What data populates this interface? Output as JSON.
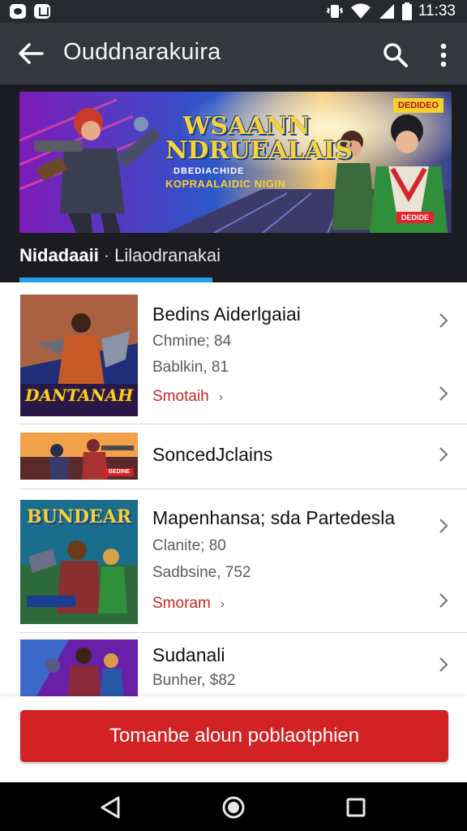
{
  "status_bar": {
    "time": "11:33",
    "icons": [
      "app-icon-a",
      "app-icon-b",
      "vibrate-icon",
      "wifi-icon",
      "signal-icon",
      "battery-icon"
    ]
  },
  "app_bar": {
    "title": "Ouddnarakuira",
    "back_icon": "arrow-left-icon",
    "search_icon": "search-icon",
    "more_icon": "more-vert-icon"
  },
  "banner": {
    "tag": "DEDIDEO",
    "title_line1": "WSAANN",
    "title_line2": "NDRUEALAIS",
    "subtitle1": "DBEDIACHIDE",
    "subtitle2": "KOPRAALAIDIC NIGIN",
    "badge": "DEDIDE"
  },
  "tabs": {
    "active": "Nidadaaii",
    "separator": "·",
    "other": "Lilaodranakai"
  },
  "list": [
    {
      "title": "Bedins Aiderlgaiai",
      "line1": "Chmine;  84",
      "line2": "Bablkin,  81",
      "price": "Smotaih",
      "price_suffix": "›",
      "thumb_label": "DANTANAH"
    },
    {
      "title": "SoncedJclains",
      "thumb_label": "BEDINE"
    },
    {
      "title": "Mapenhansa; sda Partedesla",
      "line1": "Clanite;  80",
      "line2": "Sadbsine, 752",
      "price": "Smoram",
      "price_suffix": "›",
      "thumb_label": "BUNDEAR"
    },
    {
      "title": "Sudanali",
      "line1": "Bunher, $82",
      "thumb_label": ""
    }
  ],
  "cta": {
    "label": "Tomanbe aloun poblaotphien"
  },
  "colors": {
    "accent_red": "#d32224",
    "tab_indicator": "#1fa3e8",
    "appbar": "#34383c",
    "statusbar": "#262a2e"
  }
}
